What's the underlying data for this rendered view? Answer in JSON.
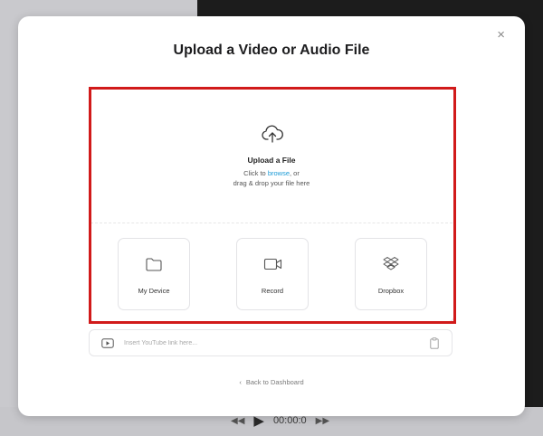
{
  "player": {
    "time": "00:00:0",
    "rewind_icon": "rewind-icon",
    "play_icon": "play-icon",
    "forward_icon": "fast-forward-icon"
  },
  "modal": {
    "title": "Upload a Video or Audio File",
    "close_label": "×"
  },
  "upload": {
    "icon": "cloud-upload-icon",
    "title": "Upload a File",
    "line1_prefix": "Click to ",
    "browse_link": "browse",
    "line1_suffix": ", or",
    "line2": "drag & drop your file here"
  },
  "sources": [
    {
      "label": "My Device",
      "icon": "folder-icon"
    },
    {
      "label": "Record",
      "icon": "video-camera-icon"
    },
    {
      "label": "Dropbox",
      "icon": "dropbox-icon"
    }
  ],
  "youtube": {
    "placeholder": "Insert YouTube link here...",
    "value": "",
    "icon": "youtube-play-icon",
    "paste_icon": "clipboard-icon"
  },
  "footer": {
    "back_label": "Back to Dashboard",
    "back_icon": "chevron-left-icon"
  },
  "colors": {
    "highlight": "#d11a1a",
    "link": "#1a9ad6",
    "backdrop_dark": "#1c1c1c"
  }
}
